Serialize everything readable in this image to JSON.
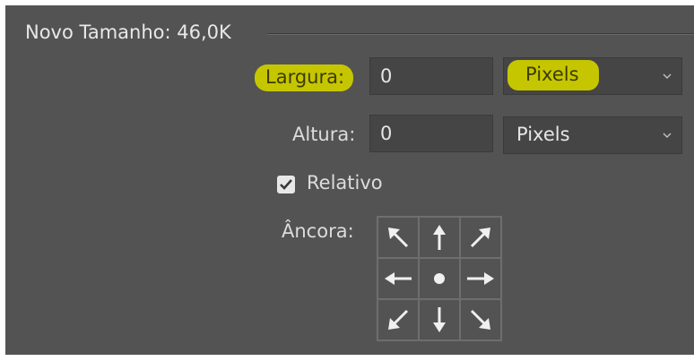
{
  "dialog": {
    "group_title": "Novo Tamanho: 46,0K",
    "width": {
      "label": "Largura:",
      "value": "0",
      "unit": "Pixels",
      "highlighted": true
    },
    "height": {
      "label": "Altura:",
      "value": "0",
      "unit": "Pixels",
      "highlighted": false
    },
    "relative": {
      "label": "Relativo",
      "checked": true
    },
    "anchor": {
      "label": "Âncora:",
      "selected": "center",
      "cells": [
        "arrow-up-left-icon",
        "arrow-up-icon",
        "arrow-up-right-icon",
        "arrow-left-icon",
        "center-dot-icon",
        "arrow-right-icon",
        "arrow-down-left-icon",
        "arrow-down-icon",
        "arrow-down-right-icon"
      ]
    }
  },
  "colors": {
    "panel_bg": "#535353",
    "field_bg": "#454545",
    "highlight": "#c6c600"
  }
}
